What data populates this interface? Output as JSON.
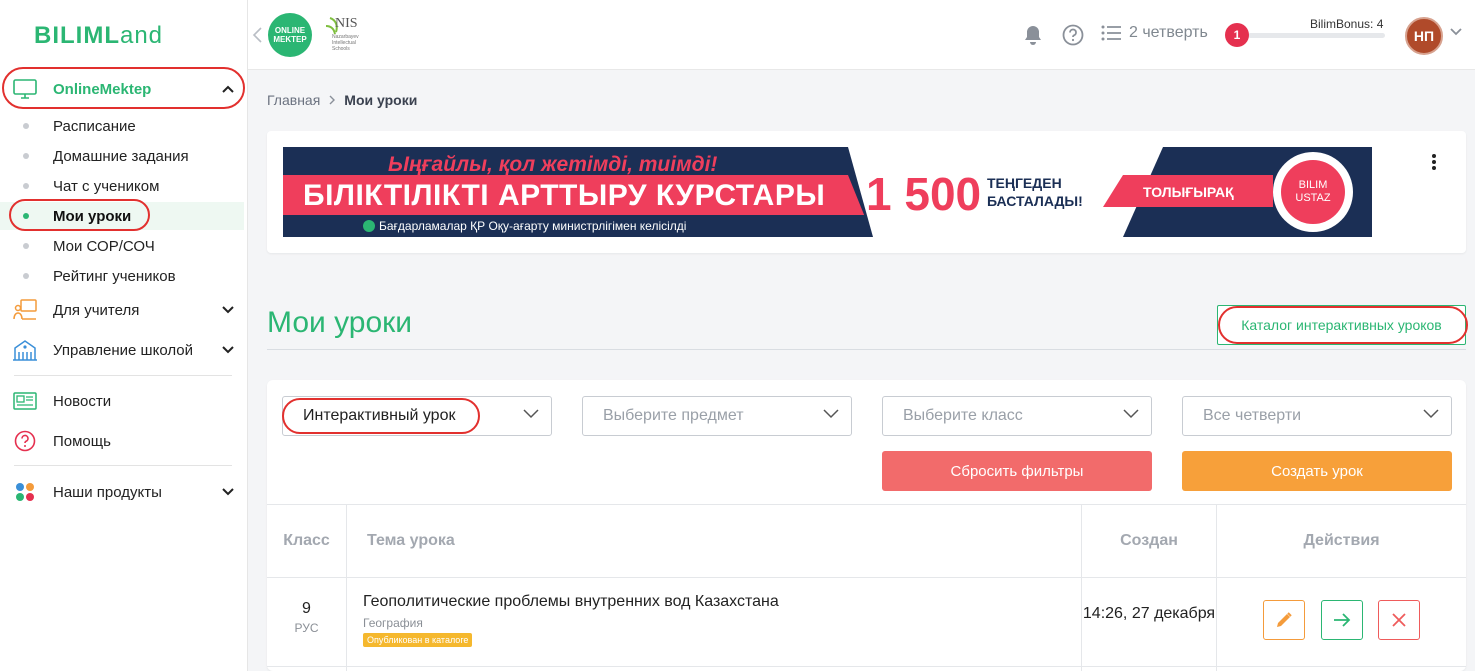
{
  "brand": {
    "logo_bold": "BILIML",
    "logo_rest": "and",
    "online_mektep_logo": "ONLINE MEKTEP",
    "nis_logo": "NIS",
    "nis_small": "Nazarbayev Intellectual Schools"
  },
  "sidebar": {
    "online_mektep": "OnlineMektep",
    "sub_items": [
      {
        "label": "Расписание"
      },
      {
        "label": "Домашние задания"
      },
      {
        "label": "Чат с учеником"
      },
      {
        "label": "Мои уроки"
      },
      {
        "label": "Мои СОР/СОЧ"
      },
      {
        "label": "Рейтинг учеников"
      }
    ],
    "for_teacher": "Для учителя",
    "school_mgmt": "Управление школой",
    "news": "Новости",
    "help": "Помощь",
    "our_products": "Наши продукты"
  },
  "header": {
    "quarter": "2 четверть",
    "bonus_count": "1",
    "bonus_label": "BilimBonus: 4",
    "avatar_initials": "НП"
  },
  "breadcrumb": {
    "home": "Главная",
    "current": "Мои уроки"
  },
  "banner": {
    "top_line": "Ыңғайлы, қол жетімді, тиімді!",
    "main_line": "БІЛІКТІЛІКТІ АРТТЫРУ КУРСТАРЫ",
    "sub_line": "Бағдарламалар ҚР Оқу-ағарту министрлігімен келісілді",
    "price": "1 500",
    "price_note_1": "ТЕҢГЕДЕН",
    "price_note_2": "БАСТАЛАДЫ!",
    "cta": "ТОЛЫҒЫРАҚ",
    "badge_1": "BILIM",
    "badge_2": "USTAZ"
  },
  "page": {
    "title": "Мои уроки",
    "catalog_button": "Каталог интерактивных уроков"
  },
  "filters": {
    "type_value": "Интерактивный урок",
    "subject_placeholder": "Выберите предмет",
    "class_placeholder": "Выберите класс",
    "quarter_placeholder": "Все четверти",
    "reset_button": "Сбросить фильтры",
    "create_button": "Создать урок"
  },
  "table": {
    "headers": {
      "grade": "Класс",
      "topic": "Тема урока",
      "created": "Создан",
      "actions": "Действия"
    },
    "rows": [
      {
        "grade": "9",
        "lang": "РУС",
        "title": "Геополитические проблемы внутренних вод Казахстана",
        "subject": "География",
        "badge": "Опубликован в каталоге",
        "created": "14:26, 27 декабря"
      }
    ]
  },
  "colors": {
    "brand_green": "#2bb673",
    "annotation_red": "#e2302e",
    "reset_red": "#f26b6b",
    "create_orange": "#f7a03a"
  }
}
